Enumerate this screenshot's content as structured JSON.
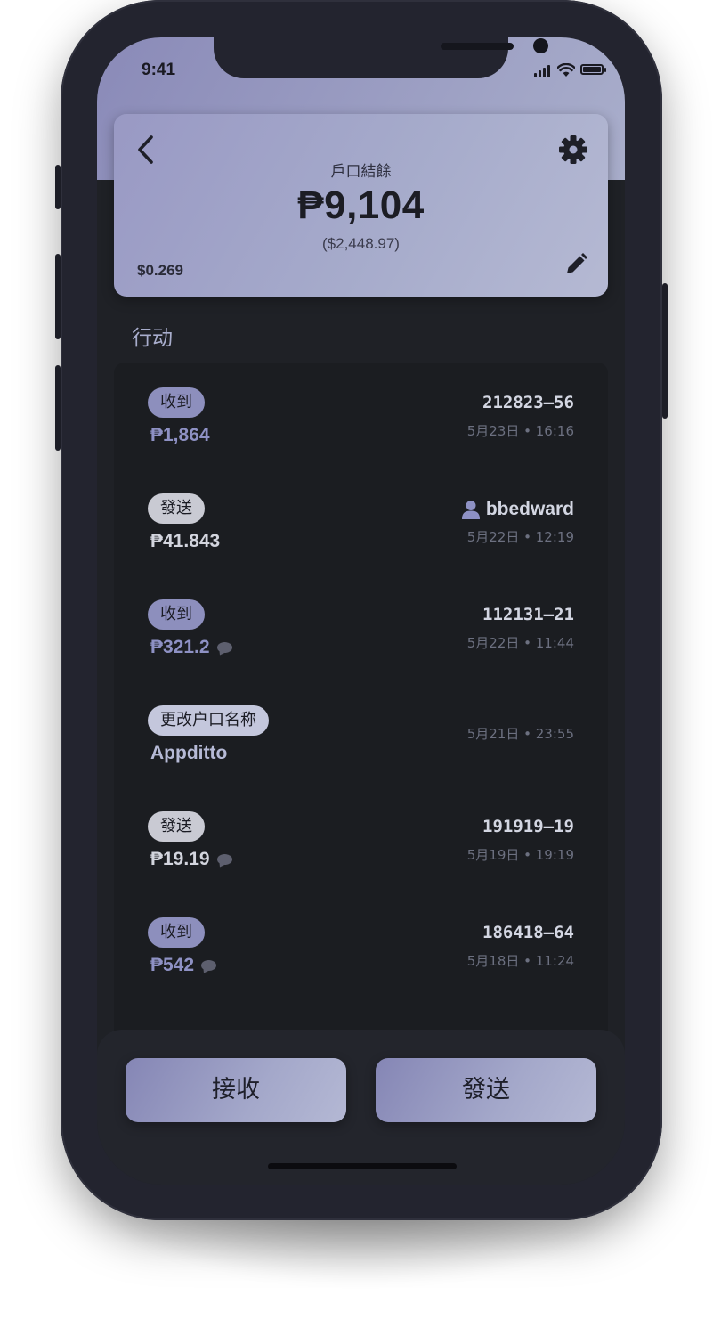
{
  "status_bar": {
    "time": "9:41"
  },
  "header": {
    "balance_label": "戶口結餘",
    "balance_amount": "₱9,104",
    "balance_fiat": "($2,448.97)",
    "rate": "$0.269"
  },
  "activity": {
    "title": "行动",
    "transactions": [
      {
        "badge": "收到",
        "type": "in",
        "amount": "₱1,864",
        "ref": "212823–56",
        "date": "5月23日 • 16:16",
        "has_memo": false
      },
      {
        "badge": "發送",
        "type": "out",
        "amount": "₱41.843",
        "ref": "bbedward",
        "date": "5月22日 • 12:19",
        "has_memo": false,
        "is_contact": true
      },
      {
        "badge": "收到",
        "type": "in",
        "amount": "₱321.2",
        "ref": "112131–21",
        "date": "5月22日 • 11:44",
        "has_memo": true
      },
      {
        "badge": "更改户口名称",
        "type": "rename",
        "amount": "Appditto",
        "ref": "",
        "date": "5月21日 • 23:55",
        "has_memo": false
      },
      {
        "badge": "發送",
        "type": "out",
        "amount": "₱19.19",
        "ref": "191919–19",
        "date": "5月19日 • 19:19",
        "has_memo": true
      },
      {
        "badge": "收到",
        "type": "in",
        "amount": "₱542",
        "ref": "186418–64",
        "date": "5月18日 • 11:24",
        "has_memo": true
      }
    ]
  },
  "actions": {
    "receive_label": "接收",
    "send_label": "發送"
  },
  "icons": {
    "back": "chevron-left-icon",
    "settings": "gear-icon",
    "edit": "pencil-icon",
    "contact": "user-icon",
    "memo": "speech-bubble-icon"
  },
  "colors": {
    "accent": "#8d8fbd",
    "incoming": "#8e91c4",
    "outgoing": "#d3d5de",
    "background": "#1f2126"
  }
}
